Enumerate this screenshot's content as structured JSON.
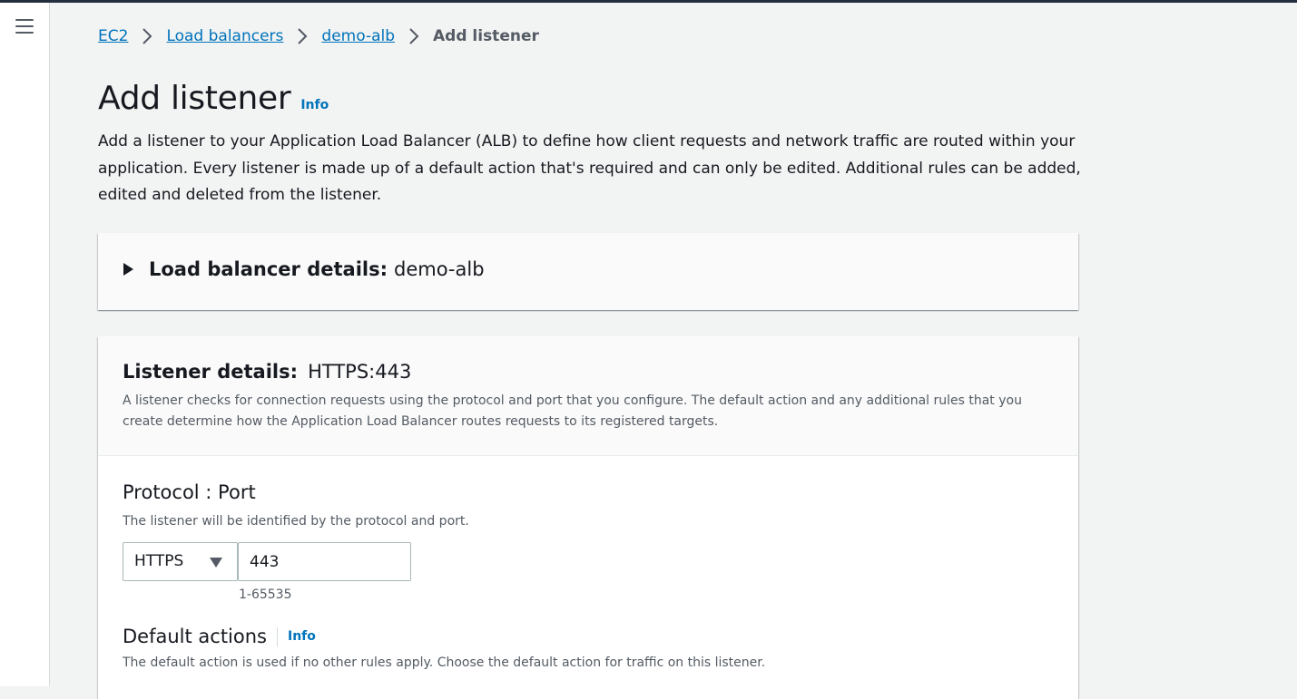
{
  "breadcrumb": {
    "items": [
      "EC2",
      "Load balancers",
      "demo-alb"
    ],
    "current": "Add listener"
  },
  "page": {
    "title": "Add listener",
    "info_label": "Info",
    "description": "Add a listener to your Application Load Balancer (ALB) to define how client requests and network traffic are routed within your application. Every listener is made up of a default action that's required and can only be edited. Additional rules can be added, edited and deleted from the listener."
  },
  "load_balancer_details": {
    "label": "Load balancer details:",
    "value": "demo-alb",
    "expanded": false
  },
  "listener_details": {
    "label": "Listener details:",
    "value": "HTTPS:443",
    "description": "A listener checks for connection requests using the protocol and port that you configure. The default action and any additional rules that you create determine how the Application Load Balancer routes requests to its registered targets."
  },
  "protocol_port": {
    "title": "Protocol : Port",
    "description": "The listener will be identified by the protocol and port.",
    "protocol": "HTTPS",
    "port": "443",
    "port_hint": "1-65535"
  },
  "default_actions": {
    "title": "Default actions",
    "info_label": "Info",
    "description": "The default action is used if no other rules apply. Choose the default action for traffic on this listener."
  },
  "colors": {
    "link": "#0073bb",
    "page_bg": "#f2f3f3",
    "top_bar": "#232f3e",
    "text": "#16191f",
    "secondary_text": "#545b64"
  },
  "icons": [
    "menu-icon",
    "chevron-right-icon",
    "caret-right-icon",
    "caret-down-icon"
  ]
}
